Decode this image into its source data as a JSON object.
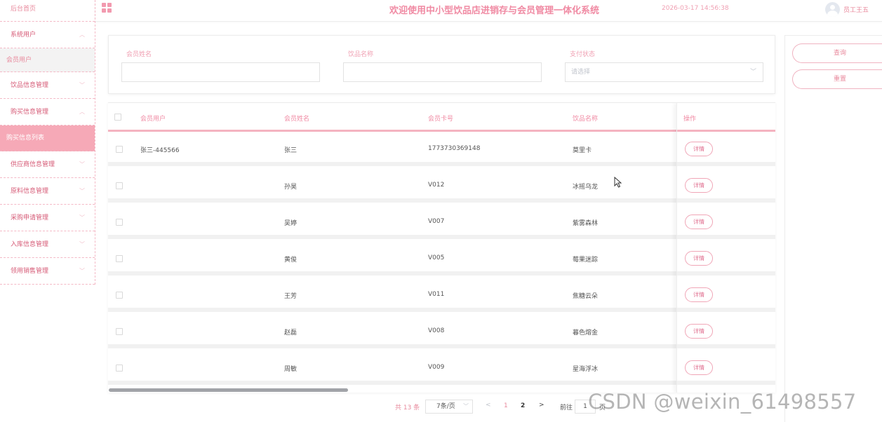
{
  "sidebar": {
    "home": "后台首页",
    "items": [
      {
        "label": "系统用户",
        "chevron": "︿"
      },
      {
        "label": "会员用户",
        "sub": true
      },
      {
        "label": "饮品信息管理",
        "chevron": "﹀"
      },
      {
        "label": "购买信息管理",
        "chevron": "︿"
      },
      {
        "label": "购买信息列表",
        "sub": true,
        "active": true
      },
      {
        "label": "供应商信息管理",
        "chevron": "﹀"
      },
      {
        "label": "原料信息管理",
        "chevron": "﹀"
      },
      {
        "label": "采购申请管理",
        "chevron": "﹀"
      },
      {
        "label": "入库信息管理",
        "chevron": "﹀"
      },
      {
        "label": "领用销售管理",
        "chevron": "﹀"
      }
    ]
  },
  "header": {
    "title": "欢迎使用中小型饮品店进销存与会员管理一体化系统",
    "datetime": "2026-03-17 14:56:38",
    "user": "员工王五",
    "menu_icon": "grid-icon",
    "avatar_icon": "user-avatar-icon"
  },
  "search": {
    "member_name_label": "会员姓名",
    "member_name_value": "",
    "drink_name_label": "饮品名称",
    "drink_name_value": "",
    "pay_status_label": "支付状态",
    "pay_status_placeholder": "请选择",
    "query_button": "查询",
    "reset_button": "重置"
  },
  "table": {
    "headers": {
      "member_user": "会员用户",
      "member_name": "会员姓名",
      "card_no": "会员卡号",
      "drink_name": "饮品名称",
      "action": "操作"
    },
    "rows": [
      {
        "member_user": "张三-445566",
        "member_name": "张三",
        "card_no": "1773730369148",
        "drink_name": "莫里卡",
        "action": "详情"
      },
      {
        "member_user": "",
        "member_name": "孙昊",
        "card_no": "V012",
        "drink_name": "冰摇乌龙",
        "action": "详情"
      },
      {
        "member_user": "",
        "member_name": "吴婷",
        "card_no": "V007",
        "drink_name": "紫雾森林",
        "action": "详情"
      },
      {
        "member_user": "",
        "member_name": "黄俊",
        "card_no": "V005",
        "drink_name": "莓果迷踪",
        "action": "详情"
      },
      {
        "member_user": "",
        "member_name": "王芳",
        "card_no": "V011",
        "drink_name": "焦糖云朵",
        "action": "详情"
      },
      {
        "member_user": "",
        "member_name": "赵磊",
        "card_no": "V008",
        "drink_name": "暮色熔金",
        "action": "详情"
      },
      {
        "member_user": "",
        "member_name": "周敏",
        "card_no": "V009",
        "drink_name": "星海浮冰",
        "action": "详情"
      }
    ]
  },
  "pagination": {
    "total": "共 13 条",
    "page_size": "7条/页",
    "prev": "<",
    "pages": [
      "1",
      "2"
    ],
    "current_page": "1",
    "next": ">",
    "goto_label": "前往",
    "goto_value": "1",
    "page_suffix": "页"
  },
  "watermark": "CSDN @weixin_61498557",
  "colors": {
    "accent": "#f08aa3",
    "active_bg": "#f6a9b7",
    "border": "#f4b3c0"
  }
}
